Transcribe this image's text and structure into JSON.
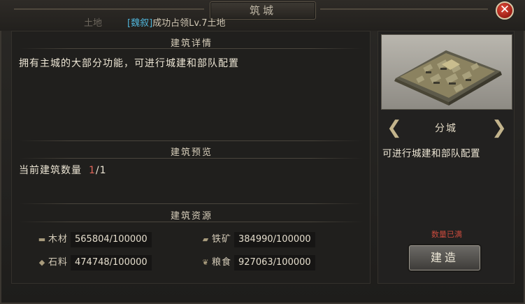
{
  "dialog": {
    "title": "筑城",
    "tag_faded": "土地",
    "tag_kingdom": "[魏叙]",
    "tag_text": "成功占领Lv.7土地",
    "close_glyph": "✕"
  },
  "details": {
    "section_title": "建筑详情",
    "description": "拥有主城的大部分功能，可进行城建和部队配置"
  },
  "preview": {
    "section_title": "建筑预览",
    "count_label": "当前建筑数量",
    "count_current": "1",
    "count_max": "/1"
  },
  "resources": {
    "section_title": "建筑资源",
    "items": [
      {
        "icon": "wood-icon",
        "label": "木材",
        "value": "565804/100000"
      },
      {
        "icon": "iron-icon",
        "label": "铁矿",
        "value": "384990/100000"
      },
      {
        "icon": "stone-icon",
        "label": "石料",
        "value": "474748/100000"
      },
      {
        "icon": "grain-icon",
        "label": "粮食",
        "value": "927063/100000"
      }
    ]
  },
  "building": {
    "name": "分城",
    "description": "可进行城建和部队配置",
    "status": "数量已满",
    "build_label": "建造",
    "prev_glyph": "❮",
    "next_glyph": "❯"
  },
  "colors": {
    "accent_kingdom": "#4fb2d6",
    "count_current": "#e2675b",
    "status_full": "#c74a3d"
  }
}
